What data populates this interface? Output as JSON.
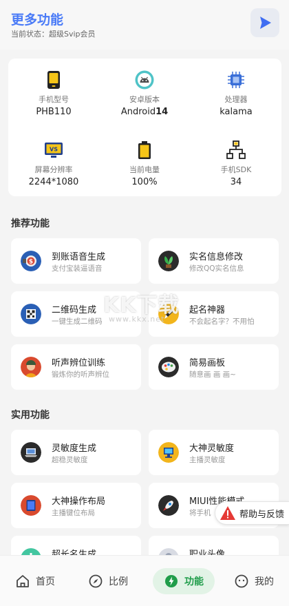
{
  "header": {
    "title": "更多功能",
    "status": "当前状态：超级Svip会员"
  },
  "device_info": [
    {
      "label": "手机型号",
      "value": "PHB110",
      "icon": "phone-icon"
    },
    {
      "label": "安卓版本",
      "value": "Android",
      "value_bold": "14",
      "icon": "android-icon"
    },
    {
      "label": "处理器",
      "value": "kalama",
      "icon": "processor-icon"
    },
    {
      "label": "屏幕分辨率",
      "value": "2244*1080",
      "icon": "screen-icon"
    },
    {
      "label": "当前电量",
      "value": "100%",
      "icon": "battery-icon"
    },
    {
      "label": "手机SDK",
      "value": "34",
      "icon": "sdk-icon"
    }
  ],
  "sections": {
    "recommended": {
      "title": "推荐功能",
      "items": [
        {
          "title": "到账语音生成",
          "desc": "支付宝装逼语音"
        },
        {
          "title": "实名信息修改",
          "desc": "修改QQ实名信息"
        },
        {
          "title": "二维码生成",
          "desc": "一键生成二维码"
        },
        {
          "title": "起名神器",
          "desc": "不会起名字？不用怕"
        },
        {
          "title": "听声辨位训练",
          "desc": "锻炼你的听声辨位"
        },
        {
          "title": "简易画板",
          "desc": "随意画 画 画~"
        }
      ]
    },
    "practical": {
      "title": "实用功能",
      "items": [
        {
          "title": "灵敏度生成",
          "desc": "超稳灵敏度"
        },
        {
          "title": "大神灵敏度",
          "desc": "主播灵敏度"
        },
        {
          "title": "大神操作布局",
          "desc": "主播键位布局"
        },
        {
          "title": "MIUI性能模式",
          "desc": "将手机"
        },
        {
          "title": "超长名生成",
          "desc": ""
        },
        {
          "title": "职业头像",
          "desc": ""
        }
      ]
    }
  },
  "watermark": {
    "text": "KK下载",
    "url": "www.kkx.net"
  },
  "help": {
    "label": "帮助与反馈"
  },
  "nav": [
    {
      "label": "首页",
      "icon": "home-icon"
    },
    {
      "label": "比例",
      "icon": "compass-icon"
    },
    {
      "label": "功能",
      "icon": "bolt-icon"
    },
    {
      "label": "我的",
      "icon": "face-icon"
    }
  ],
  "colors": {
    "accent": "#4a7bf7",
    "nav_active": "#1f9d4a",
    "nav_active_bg": "#e2f3e6"
  }
}
